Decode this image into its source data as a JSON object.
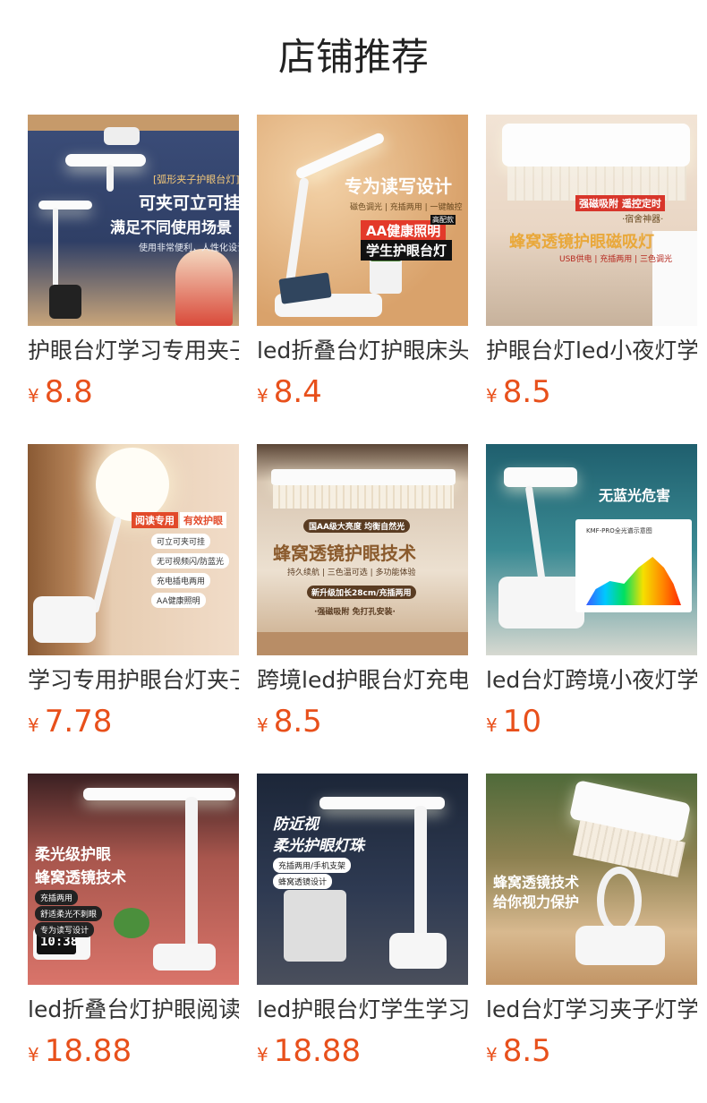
{
  "page": {
    "title": "店铺推荐"
  },
  "currency": "¥",
  "products": [
    {
      "name": "护眼台灯学习专用夹子",
      "price": "8.8",
      "overlay": [
        "[弧形夹子护眼台灯]",
        "可夹可立可挂",
        "满足不同使用场景",
        "使用非常便利，人性化设计"
      ]
    },
    {
      "name": "led折叠台灯护眼床头",
      "price": "8.4",
      "overlay": [
        "专为读写设计",
        "磁色调光 | 充插两用 | 一键触控",
        "AA健康照明",
        "学生护眼台灯",
        "高配款"
      ]
    },
    {
      "name": "护眼台灯led小夜灯学",
      "price": "8.5",
      "overlay": [
        "强磁吸附  遥控定时",
        "·宿舍神器·",
        "蜂窝透镜护眼磁吸灯",
        "USB供电 | 充插两用 | 三色调光"
      ]
    },
    {
      "name": "学习专用护眼台灯夹子",
      "price": "7.78",
      "overlay": [
        "阅读专用",
        "有效护眼",
        "可立可夹可挂",
        "无可视频闪/防蓝光",
        "充电插电两用",
        "AA健康照明"
      ]
    },
    {
      "name": "跨境led护眼台灯充电",
      "price": "8.5",
      "overlay": [
        "国AA级大亮度  均衡自然光",
        "蜂窝透镜护眼技术",
        "持久续航 | 三色温可选 | 多功能体验",
        "新升级加长28cm/充插两用",
        "·强磁吸附  免打孔安装·"
      ]
    },
    {
      "name": "led台灯跨境小夜灯学",
      "price": "10",
      "overlay": [
        "无蓝光危害",
        "KMF-PRO全光谱示意图"
      ]
    },
    {
      "name": "led折叠台灯护眼阅读",
      "price": "18.88",
      "overlay": [
        "柔光级护眼",
        "蜂窝透镜技术",
        "充插两用",
        "舒适柔光不刺眼",
        "专为读写设计",
        "10:38"
      ]
    },
    {
      "name": "led护眼台灯学生学习",
      "price": "18.88",
      "overlay": [
        "防近视",
        "柔光护眼灯珠",
        "充插两用/手机支架",
        "蜂窝透镜设计"
      ]
    },
    {
      "name": "led台灯学习夹子灯学",
      "price": "8.5",
      "overlay": [
        "蜂窝透镜技术",
        "给你视力保护"
      ]
    }
  ],
  "colors": {
    "price": "#e8501b",
    "title": "#222222"
  }
}
